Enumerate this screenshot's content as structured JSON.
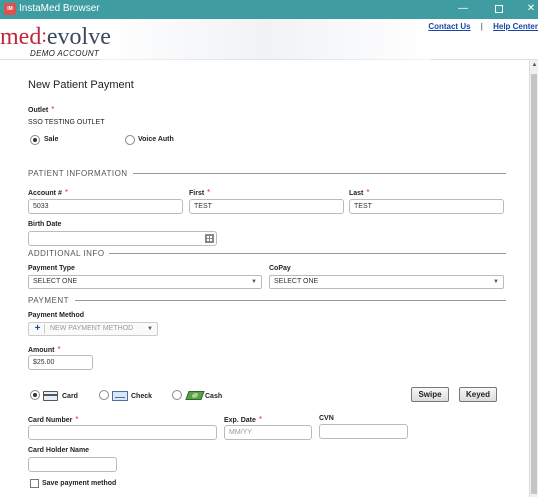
{
  "window": {
    "title": "InstaMed Browser",
    "app_icon_text": "IM",
    "minimize": "—",
    "close": "✕"
  },
  "header": {
    "logo_med": "med",
    "logo_evolve": "evolve",
    "demo_label": "DEMO ACCOUNT",
    "contact_link": "Contact Us",
    "help_link": "Help Center"
  },
  "form": {
    "title": "New Patient Payment",
    "outlet_label": "Outlet",
    "outlet_value": "SSO TESTING OUTLET",
    "transaction_types": [
      {
        "label": "Sale",
        "selected": true
      },
      {
        "label": "Voice Auth",
        "selected": false
      }
    ],
    "patient_section": "PATIENT INFORMATION",
    "account_label": "Account #",
    "account_value": "5033",
    "first_label": "First",
    "first_value": "TEST",
    "last_label": "Last",
    "last_value": "TEST",
    "birthdate_label": "Birth Date",
    "birthdate_value": "",
    "additional_section": "ADDITIONAL INFO",
    "payment_type_label": "Payment Type",
    "payment_type_value": "SELECT ONE",
    "copay_label": "CoPay",
    "copay_value": "SELECT ONE",
    "payment_section": "PAYMENT",
    "payment_method_label": "Payment Method",
    "payment_method_value": "NEW PAYMENT METHOD",
    "amount_label": "Amount",
    "amount_value": "$25.00",
    "tender_types": [
      {
        "label": "Card",
        "icon": "credit-card-icon",
        "selected": true
      },
      {
        "label": "Check",
        "icon": "check-icon",
        "selected": false
      },
      {
        "label": "Cash",
        "icon": "cash-icon",
        "selected": false
      }
    ],
    "swipe_label": "Swipe",
    "keyed_label": "Keyed",
    "card_number_label": "Card Number",
    "card_number_value": "",
    "exp_date_label": "Exp. Date",
    "exp_date_placeholder": "MM/YY",
    "cvn_label": "CVN",
    "cvn_value": "",
    "card_holder_label": "Card Holder Name",
    "card_holder_value": "",
    "save_method_label": "Save payment method",
    "save_method_checked": false,
    "required_marker": "*"
  },
  "colors": {
    "titlebar": "#3f9da1",
    "brand_red": "#c3253c",
    "link_blue": "#1a46a8",
    "required_red": "#dd3333"
  }
}
